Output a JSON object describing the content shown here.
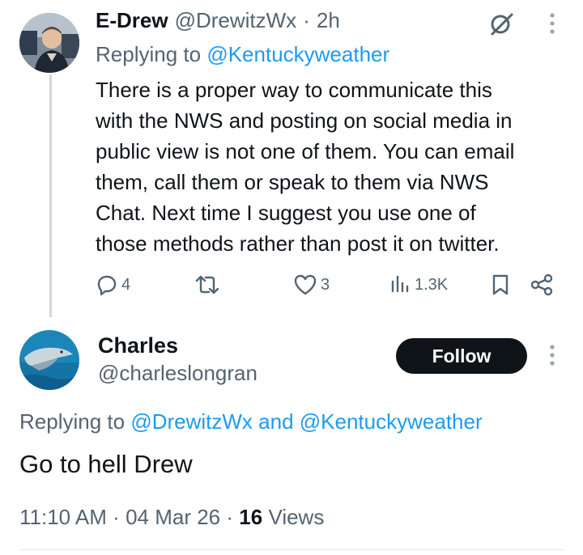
{
  "reply_tweet": {
    "author_name": "E-Drew",
    "author_handle": "@DrewitzWx",
    "separator": "·",
    "time": "2h",
    "replying_prefix": "Replying to",
    "replying_to": "@Kentuckyweather",
    "text_lines": [
      "There is a proper way to communicate this",
      "with the NWS and posting on social media in",
      "public view is not one of them. You can email",
      "them, call them or speak to them via NWS",
      "Chat. Next time I suggest you use one of",
      "those methods rather than post it on twitter."
    ],
    "replies": "4",
    "likes": "3",
    "views": "1.3K"
  },
  "main_tweet": {
    "author_name": "Charles",
    "author_handle": "@charleslongran",
    "follow_label": "Follow",
    "replying_prefix": "Replying to",
    "replying_to_1": "@DrewitzWx",
    "replying_and": "and",
    "replying_to_2": "@Kentuckyweather",
    "text": "Go to hell Drew",
    "time": "11:10 AM",
    "date": "04 Mar 26",
    "sep": "·",
    "views_count": "16",
    "views_label": "Views"
  },
  "icons": {
    "grok": "grok-slash-icon",
    "more": "more-vertical-icon",
    "reply": "reply-icon",
    "retweet": "retweet-icon",
    "like": "heart-icon",
    "views": "views-bars-icon",
    "bookmark": "bookmark-icon",
    "share": "share-icon"
  },
  "colors": {
    "link": "#1d9bf0",
    "muted": "#536471",
    "text": "#0f1419",
    "button": "#0f1419"
  }
}
